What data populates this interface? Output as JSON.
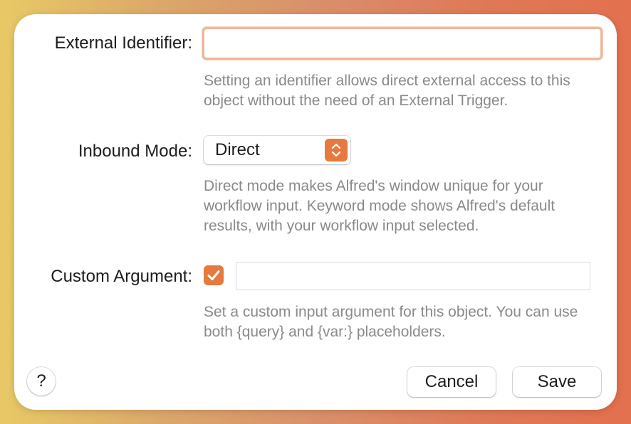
{
  "form": {
    "external_identifier": {
      "label": "External Identifier:",
      "value": "",
      "help": "Setting an identifier allows direct external access to this object without the need of an External Trigger."
    },
    "inbound_mode": {
      "label": "Inbound Mode:",
      "selected": "Direct",
      "help": "Direct mode makes Alfred's window unique for your workflow input. Keyword mode shows Alfred's default results, with your workflow input selected."
    },
    "custom_argument": {
      "label": "Custom Argument:",
      "checked": true,
      "value": "",
      "help": "Set a custom input argument for this object. You can use both {query} and {var:} placeholders."
    }
  },
  "footer": {
    "help_label": "?",
    "cancel_label": "Cancel",
    "save_label": "Save"
  },
  "colors": {
    "accent": "#e67a3e",
    "focus_ring": "#ecb79c",
    "help_text": "#8a8a8a"
  }
}
